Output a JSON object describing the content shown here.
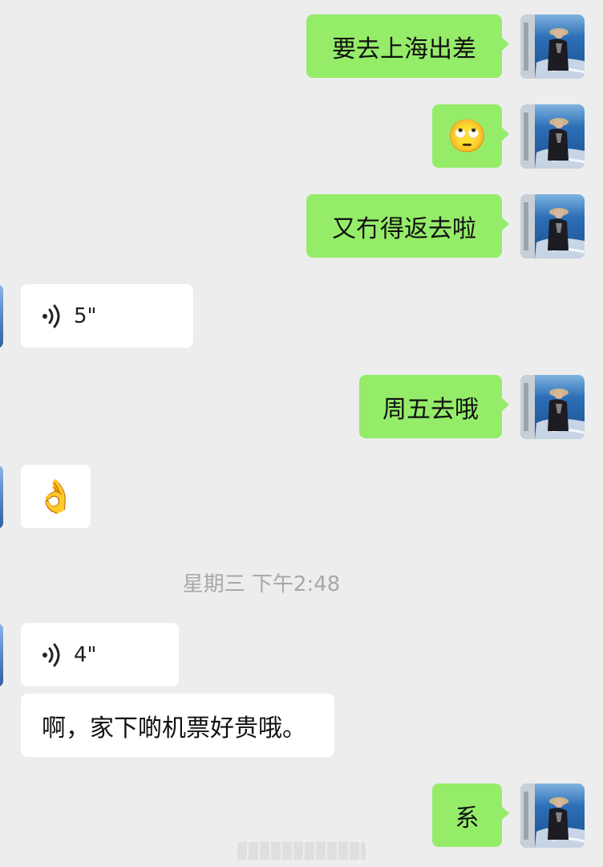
{
  "messages": [
    {
      "side": "out",
      "text": "要去上海出差"
    },
    {
      "side": "out",
      "emoji": "🙄",
      "emoji_name": "eye-roll-emoji"
    },
    {
      "side": "out",
      "text": "又冇得返去啦"
    },
    {
      "side": "in",
      "voice_duration": "5\""
    },
    {
      "side": "out",
      "text": "周五去哦"
    },
    {
      "side": "in",
      "emoji": "👌",
      "emoji_name": "ok-hand-emoji"
    },
    {
      "side": "in",
      "voice_duration": "4\""
    },
    {
      "side": "in",
      "text": "啊，家下啲机票好贵哦。"
    },
    {
      "side": "out",
      "text": "系"
    }
  ],
  "timestamp": "星期三 下午2:48",
  "colors": {
    "background": "#ededed",
    "outgoing_bubble": "#95ec69",
    "incoming_bubble": "#ffffff",
    "timestamp_text": "#a8a8a8"
  },
  "icons": {
    "voice": "voice-wave-icon",
    "avatar": "user-avatar"
  }
}
